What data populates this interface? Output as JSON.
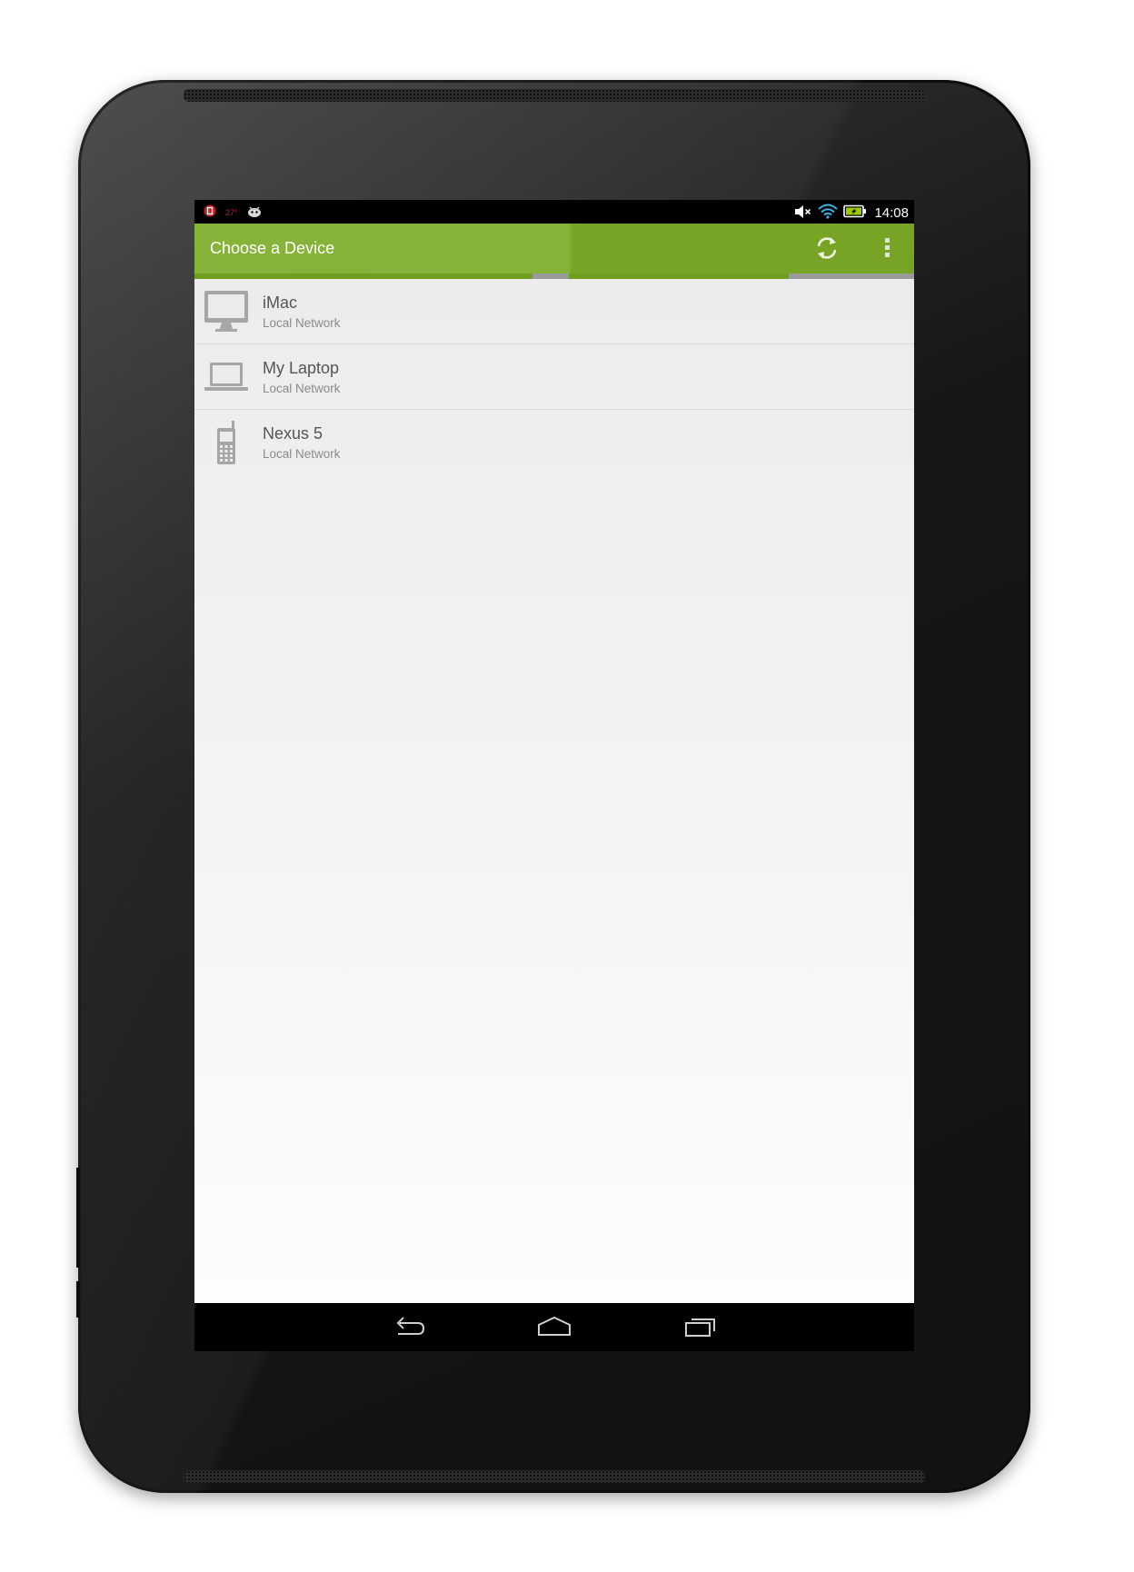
{
  "status_bar": {
    "time": "14:08",
    "notification_icons": [
      "alarm-icon",
      "temperature-icon",
      "android-icon"
    ],
    "temperature_label": "27°",
    "system_icons": [
      "volume-muted-icon",
      "wifi-icon",
      "battery-charging-icon"
    ]
  },
  "action_bar": {
    "title": "Choose a Device",
    "actions": [
      "refresh-icon",
      "overflow-menu-icon"
    ],
    "accent_color": "#88b33a",
    "accent_color_dark": "#77a424"
  },
  "devices": [
    {
      "name": "iMac",
      "subtitle": "Local Network",
      "icon": "desktop-icon"
    },
    {
      "name": "My Laptop",
      "subtitle": "Local Network",
      "icon": "laptop-icon"
    },
    {
      "name": "Nexus 5",
      "subtitle": "Local Network",
      "icon": "phone-icon"
    }
  ],
  "nav_bar": {
    "buttons": [
      "back-icon",
      "home-icon",
      "recents-icon"
    ]
  }
}
